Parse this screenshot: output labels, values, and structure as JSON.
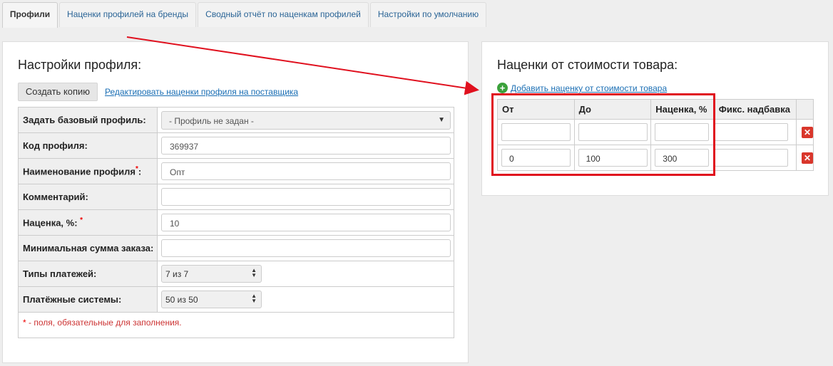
{
  "tabs": [
    {
      "label": "Профили",
      "active": true
    },
    {
      "label": "Наценки профилей на бренды",
      "active": false
    },
    {
      "label": "Сводный отчёт по наценкам профилей",
      "active": false
    },
    {
      "label": "Настройки по умолчанию",
      "active": false
    }
  ],
  "profile_settings": {
    "title": "Настройки профиля:",
    "copy_button": "Создать копию",
    "edit_link": "Редактировать наценки профиля на поставщика",
    "fields": {
      "base_profile": {
        "label": "Задать базовый профиль:",
        "value": "- Профиль не задан -"
      },
      "code": {
        "label": "Код профиля:",
        "value": "369937"
      },
      "name": {
        "label": "Наименование профиля",
        "required_mark": "*",
        "suffix": ":",
        "value": "Опт"
      },
      "comment": {
        "label": "Комментарий:",
        "value": ""
      },
      "markup": {
        "label": "Наценка, %:",
        "required_mark": "*",
        "value": "10"
      },
      "min_order": {
        "label": "Минимальная сумма заказа:",
        "value": ""
      },
      "payment_types": {
        "label": "Типы платежей:",
        "value": "7 из 7"
      },
      "payment_systems": {
        "label": "Платёжные системы:",
        "value": "50 из 50"
      }
    },
    "required_note_star": "*",
    "required_note": " - поля, обязательные для заполнения."
  },
  "price_markups": {
    "title": "Наценки от стоимости товара:",
    "add_link": "Добавить наценку от стоимости товара",
    "columns": [
      "От",
      "До",
      "Наценка, %",
      "Фикс. надбавка"
    ],
    "rows": [
      {
        "from": "",
        "to": "",
        "markup": "",
        "fixed": ""
      },
      {
        "from": "0",
        "to": "100",
        "markup": "300",
        "fixed": ""
      }
    ]
  },
  "colors": {
    "annotation": "#e0101e",
    "link": "#1a6eb4",
    "delete": "#d9362b",
    "add": "#3ba13b"
  },
  "icons": {
    "add": "plus-circle-icon",
    "delete": "close-icon",
    "select": "chevron-down-icon",
    "spinner": "updown-icon"
  }
}
